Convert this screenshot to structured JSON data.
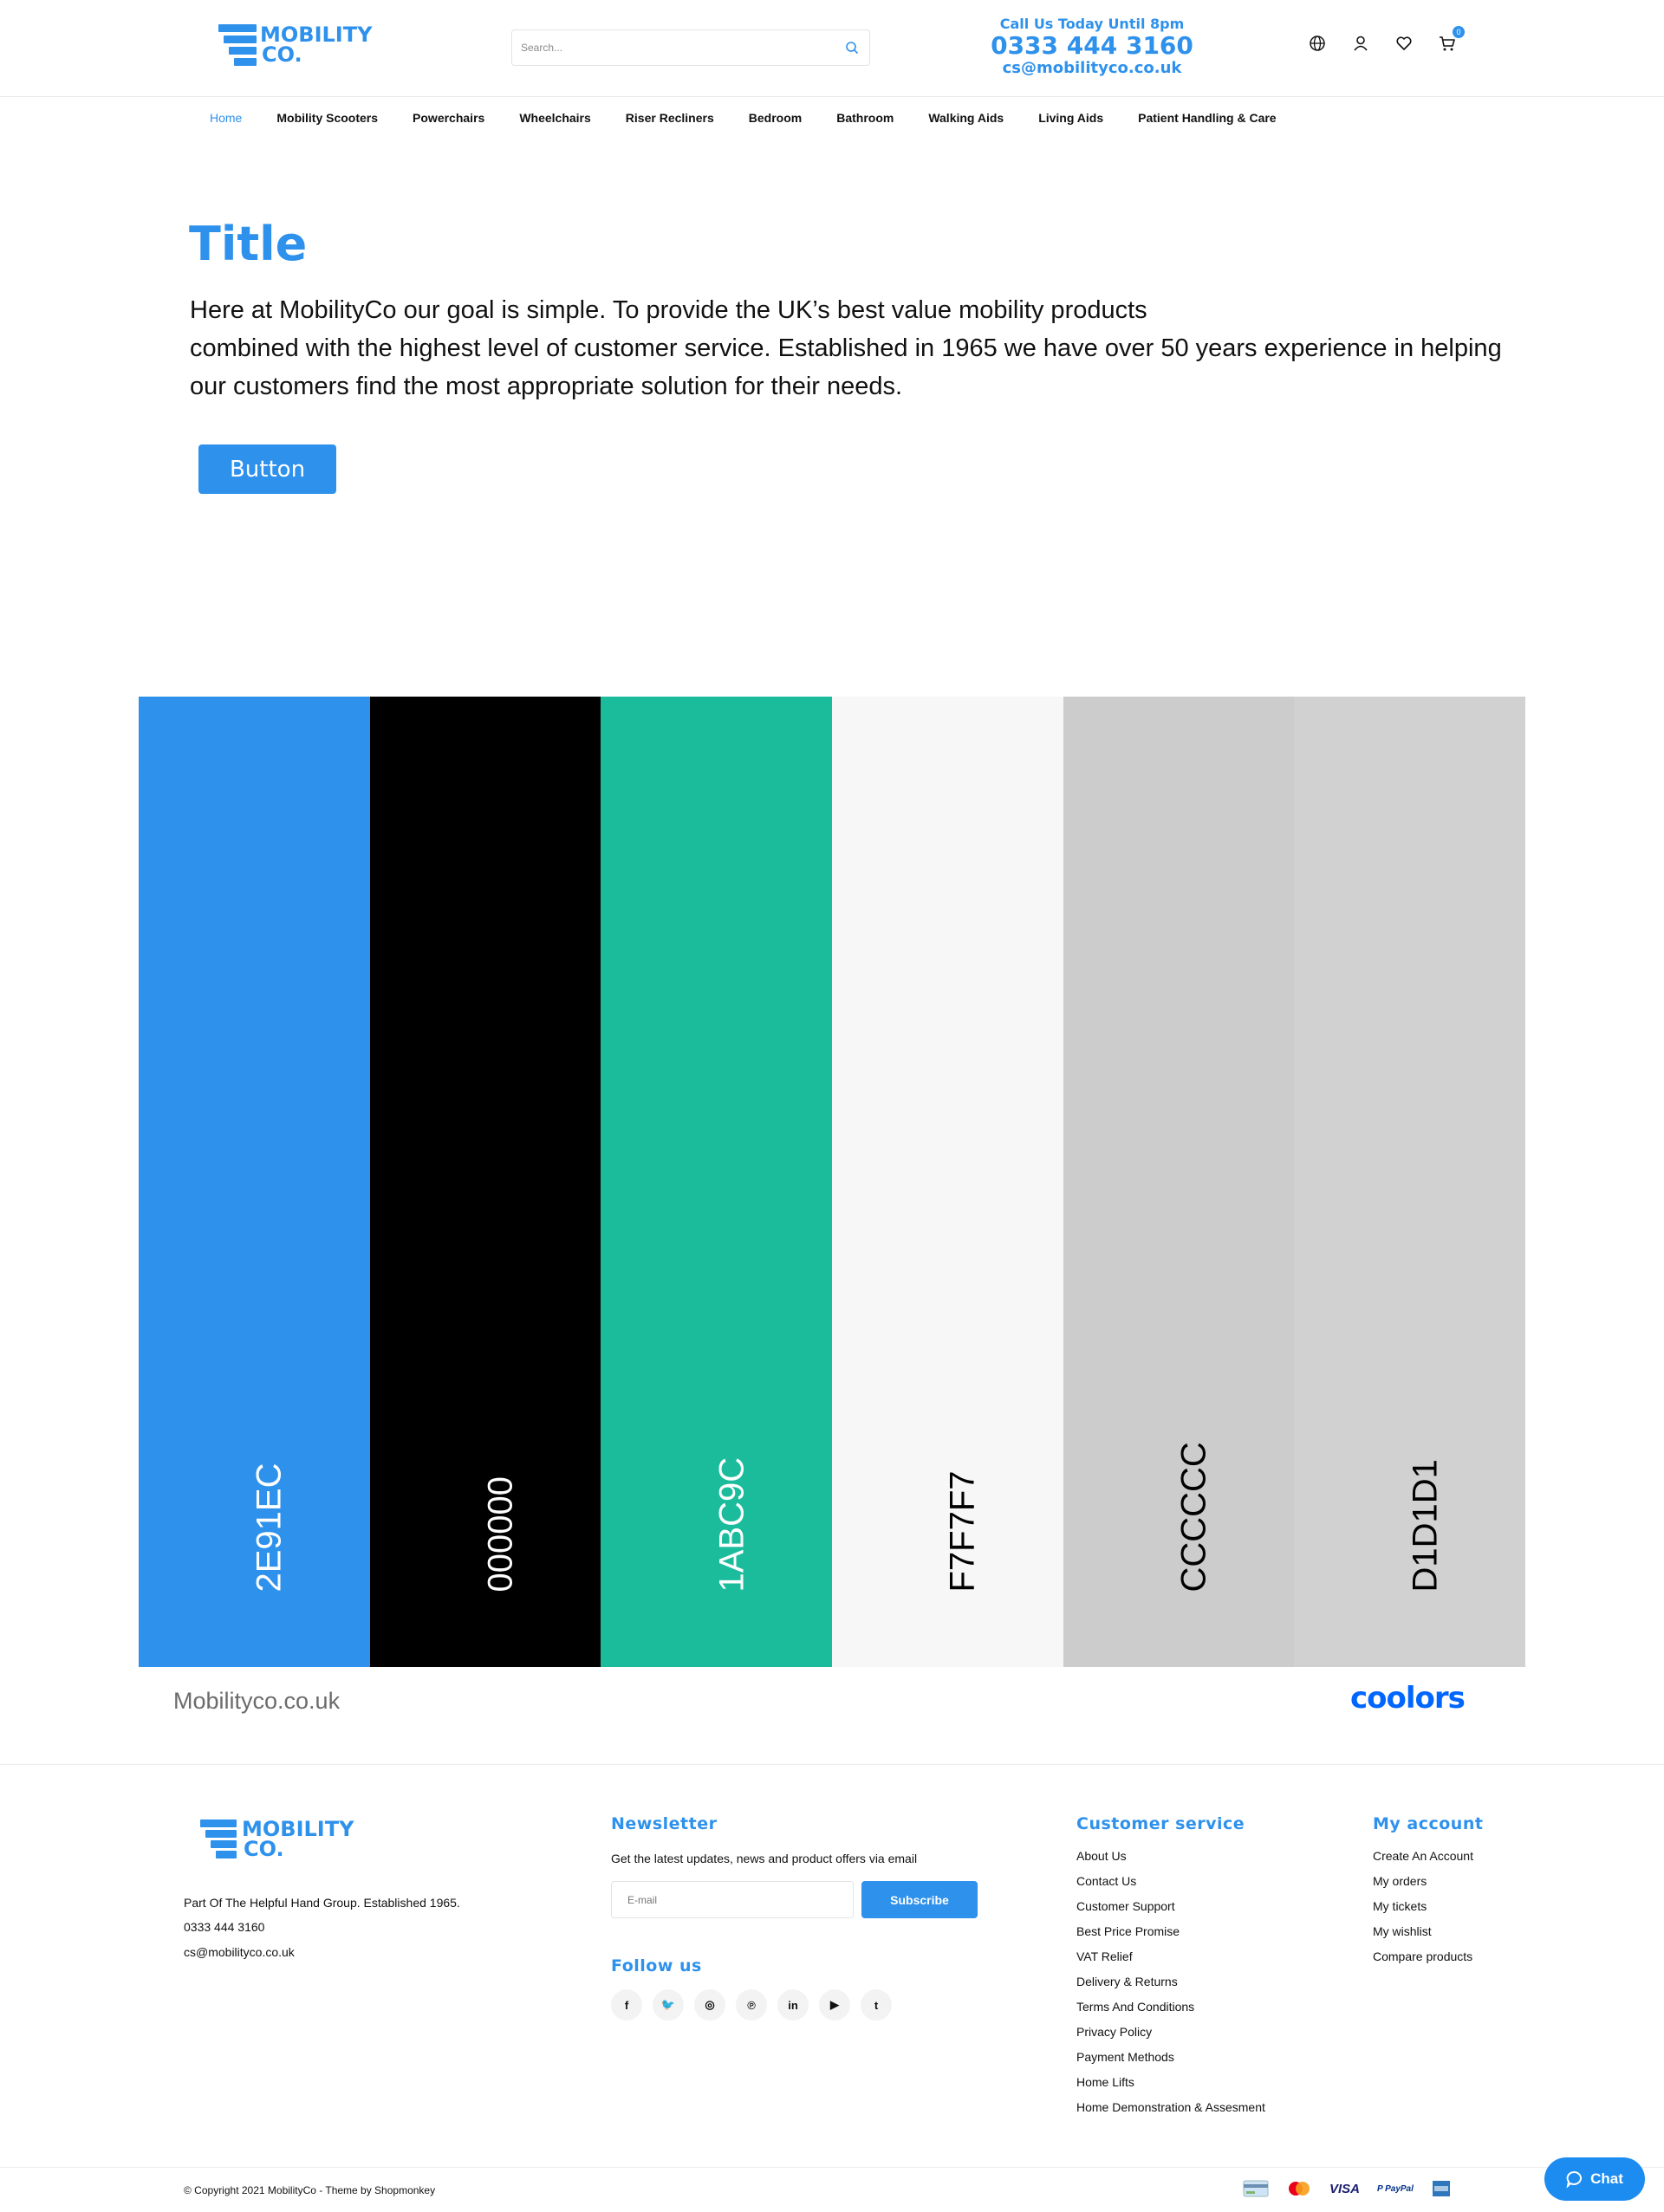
{
  "header": {
    "logo": {
      "line1": "MOBILITY",
      "line2": "CO."
    },
    "search": {
      "placeholder": "Search..."
    },
    "contact": {
      "call_label": "Call Us Today Until 8pm",
      "phone": "0333 444 3160",
      "email": "cs@mobilityco.co.uk"
    },
    "icons": [
      "globe-icon",
      "user-icon",
      "heart-icon",
      "cart-icon"
    ],
    "cart_count": "0"
  },
  "nav": {
    "items": [
      {
        "label": "Home",
        "active": true
      },
      {
        "label": "Mobility Scooters"
      },
      {
        "label": "Powerchairs"
      },
      {
        "label": "Wheelchairs"
      },
      {
        "label": "Riser Recliners"
      },
      {
        "label": "Bedroom"
      },
      {
        "label": "Bathroom"
      },
      {
        "label": "Walking Aids"
      },
      {
        "label": "Living Aids"
      },
      {
        "label": "Patient Handling & Care"
      }
    ]
  },
  "hero": {
    "title": "Title",
    "text": "Here at MobilityCo our goal is simple. To provide the UK’s best value mobility products\ncombined with the highest level of customer service. Established in 1965 we have over 50 years experience in helping\nour customers find the most appropriate solution for their needs.",
    "button": "Button"
  },
  "palette": {
    "swatches": [
      {
        "code": "2E91EC",
        "color": "#2E91EC",
        "text_color": "#ffffff"
      },
      {
        "code": "000000",
        "color": "#000000",
        "text_color": "#ffffff"
      },
      {
        "code": "1ABC9C",
        "color": "#1ABC9C",
        "text_color": "#ffffff"
      },
      {
        "code": "F7F7F7",
        "color": "#F7F7F7",
        "text_color": "#000000"
      },
      {
        "code": "CCCCCC",
        "color": "#CCCCCC",
        "text_color": "#000000"
      },
      {
        "code": "D1D1D1",
        "color": "#D1D1D1",
        "text_color": "#000000"
      }
    ],
    "site": "Mobilityco.co.uk",
    "brand": "coolors"
  },
  "footer": {
    "about": {
      "text": "Part Of The Helpful Hand Group. Established 1965.",
      "phone": "0333 444 3160",
      "email": "cs@mobilityco.co.uk"
    },
    "newsletter": {
      "heading": "Newsletter",
      "text": "Get the latest updates, news and product offers via email",
      "placeholder": "E-mail",
      "button": "Subscribe"
    },
    "follow": {
      "heading": "Follow us",
      "socials": [
        {
          "name": "facebook-icon",
          "glyph": "f"
        },
        {
          "name": "twitter-icon",
          "glyph": "🐦"
        },
        {
          "name": "instagram-icon",
          "glyph": "◎"
        },
        {
          "name": "pinterest-icon",
          "glyph": "℗"
        },
        {
          "name": "linkedin-icon",
          "glyph": "in"
        },
        {
          "name": "youtube-icon",
          "glyph": "▶"
        },
        {
          "name": "tumblr-icon",
          "glyph": "t"
        }
      ]
    },
    "customer_service": {
      "heading": "Customer service",
      "links": [
        "About Us",
        "Contact Us",
        "Customer Support",
        "Best Price Promise",
        "VAT Relief",
        "Delivery & Returns",
        "Terms And Conditions",
        "Privacy Policy",
        "Payment Methods",
        "Home Lifts",
        "Home Demonstration & Assesment"
      ]
    },
    "my_account": {
      "heading": "My account",
      "links": [
        "Create An Account",
        "My orders",
        "My tickets",
        "My wishlist",
        "Compare products"
      ]
    },
    "copyright": "© Copyright 2021 MobilityCo - Theme by Shopmonkey",
    "payments": [
      {
        "name": "card-icon",
        "label": ""
      },
      {
        "name": "mastercard-icon",
        "label": ""
      },
      {
        "name": "visa-icon",
        "label": "VISA"
      },
      {
        "name": "paypal-icon",
        "label": "P PayPal"
      },
      {
        "name": "amex-icon",
        "label": ""
      }
    ]
  },
  "chat": {
    "label": "Chat"
  },
  "colors": {
    "brand": "#2E91EC",
    "chat": "#1d8cf0"
  }
}
